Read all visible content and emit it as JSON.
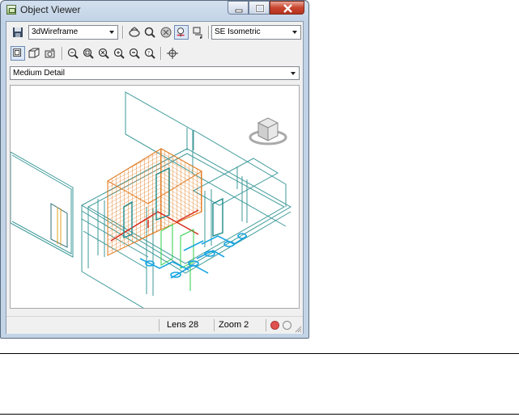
{
  "window": {
    "title": "Object Viewer",
    "icon": "object-viewer-app-icon"
  },
  "toolbar1": {
    "visual_style": "3dWireframe",
    "view": "SE Isometric",
    "buttons": [
      "save-icon",
      "orbit-icon",
      "zoom-icon",
      "visual-style-icon",
      "light-icon",
      "set-view-icon"
    ]
  },
  "toolbar2": {
    "buttons": [
      "top-view-icon",
      "ucs-icon",
      "camera-icon",
      "zoom-realtime-icon",
      "zoom-window-icon",
      "zoom-extents-icon",
      "zoom-in-icon",
      "zoom-out-icon",
      "zoom-previous-icon",
      "target-icon"
    ]
  },
  "detail": {
    "level": "Medium Detail"
  },
  "status": {
    "lens": "Lens 28",
    "zoom": "Zoom 2"
  },
  "colors": {
    "window_frame": "#c0d2e6",
    "close_button": "#c8452e",
    "status_red": "#e0524d",
    "wall_teal": "#3f9a9a",
    "wall_orange": "#e07a1e",
    "pipe_cyan": "#19a6e0"
  }
}
